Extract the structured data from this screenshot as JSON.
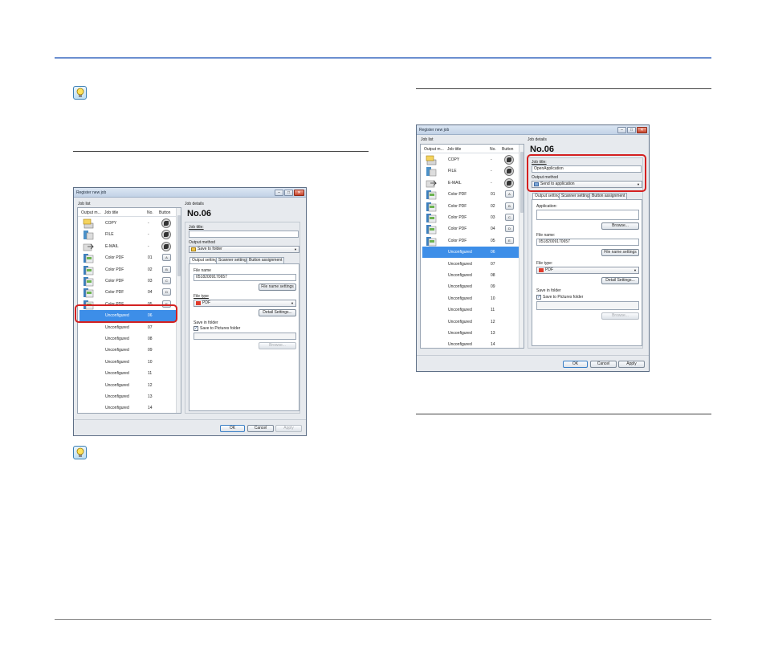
{
  "left_window": {
    "title": "Register new job",
    "job_list_label": "Job list",
    "job_details_label": "Job details",
    "columns": [
      "Output m...",
      "Job title",
      "No.",
      "Button"
    ],
    "rows": [
      {
        "title": "COPY",
        "no": "-",
        "button": "round"
      },
      {
        "title": "FILE",
        "no": "-",
        "button": "round"
      },
      {
        "title": "E-MAIL",
        "no": "-",
        "button": "round"
      },
      {
        "title": "Color PDF",
        "no": "01",
        "button": "A"
      },
      {
        "title": "Color PDF",
        "no": "02",
        "button": "B"
      },
      {
        "title": "Color PDF",
        "no": "03",
        "button": "C"
      },
      {
        "title": "Color PDF",
        "no": "04",
        "button": "D"
      },
      {
        "title": "Color PDF",
        "no": "05",
        "button": "E"
      },
      {
        "title": "Unconfigured",
        "no": "06",
        "selected": true
      },
      {
        "title": "Unconfigured",
        "no": "07"
      },
      {
        "title": "Unconfigured",
        "no": "08"
      },
      {
        "title": "Unconfigured",
        "no": "09"
      },
      {
        "title": "Unconfigured",
        "no": "10"
      },
      {
        "title": "Unconfigured",
        "no": "11"
      },
      {
        "title": "Unconfigured",
        "no": "12"
      },
      {
        "title": "Unconfigured",
        "no": "13"
      },
      {
        "title": "Unconfigured",
        "no": "14"
      }
    ],
    "job_no": "No.06",
    "job_title_label": "Job title:",
    "job_title_value": "",
    "output_method_label": "Output method",
    "output_method_value": "Save to folder",
    "tabs": [
      "Output settings",
      "Scanner setting",
      "Button assignment"
    ],
    "file_name_label": "File name",
    "file_name_value": "05182009170657",
    "file_name_settings_button": "File name settings",
    "file_type_label": "File type",
    "file_type_value": "PDF",
    "detail_settings_button": "Detail Settings...",
    "save_in_folder_label": "Save in folder",
    "save_to_pictures_label": "Save to Pictures folder",
    "browse_button": "Browse...",
    "ok_button": "OK",
    "cancel_button": "Cancel",
    "apply_button": "Apply"
  },
  "right_window": {
    "title": "Register new job",
    "job_list_label": "Job list",
    "job_details_label": "Job details",
    "columns": [
      "Output m...",
      "Job title",
      "No.",
      "Button"
    ],
    "rows": [
      {
        "title": "COPY",
        "no": "-",
        "button": "round"
      },
      {
        "title": "FILE",
        "no": "-",
        "button": "round"
      },
      {
        "title": "E-MAIL",
        "no": "-",
        "button": "round"
      },
      {
        "title": "Color PDF",
        "no": "01",
        "button": "A"
      },
      {
        "title": "Color PDF",
        "no": "02",
        "button": "B"
      },
      {
        "title": "Color PDF",
        "no": "03",
        "button": "C"
      },
      {
        "title": "Color PDF",
        "no": "04",
        "button": "D"
      },
      {
        "title": "Color PDF",
        "no": "05",
        "button": "E"
      },
      {
        "title": "Unconfigured",
        "no": "06",
        "selected": true
      },
      {
        "title": "Unconfigured",
        "no": "07"
      },
      {
        "title": "Unconfigured",
        "no": "08"
      },
      {
        "title": "Unconfigured",
        "no": "09"
      },
      {
        "title": "Unconfigured",
        "no": "10"
      },
      {
        "title": "Unconfigured",
        "no": "11"
      },
      {
        "title": "Unconfigured",
        "no": "12"
      },
      {
        "title": "Unconfigured",
        "no": "13"
      },
      {
        "title": "Unconfigured",
        "no": "14"
      }
    ],
    "job_no": "No.06",
    "job_title_label": "Job title:",
    "job_title_value": "OpenApplication",
    "output_method_label": "Output method",
    "output_method_value": "Send to application",
    "tabs": [
      "Output settings",
      "Scanner setting",
      "Button assignment"
    ],
    "application_label": "Application:",
    "browse_app_button": "Browse...",
    "file_name_label": "File name:",
    "file_name_value": "05182009170657",
    "file_name_settings_button": "File name settings",
    "file_type_label": "File type:",
    "file_type_value": "PDF",
    "detail_settings_button": "Detail Settings...",
    "save_in_folder_label": "Save in folder",
    "save_to_pictures_label": "Save to Pictures folder",
    "browse_button": "Browse...",
    "ok_button": "OK",
    "cancel_button": "Cancel",
    "apply_button": "Apply"
  },
  "colors": {
    "accent_rule": "#6b8fd0",
    "selection": "#3d8ee8",
    "highlight": "#d42020"
  }
}
